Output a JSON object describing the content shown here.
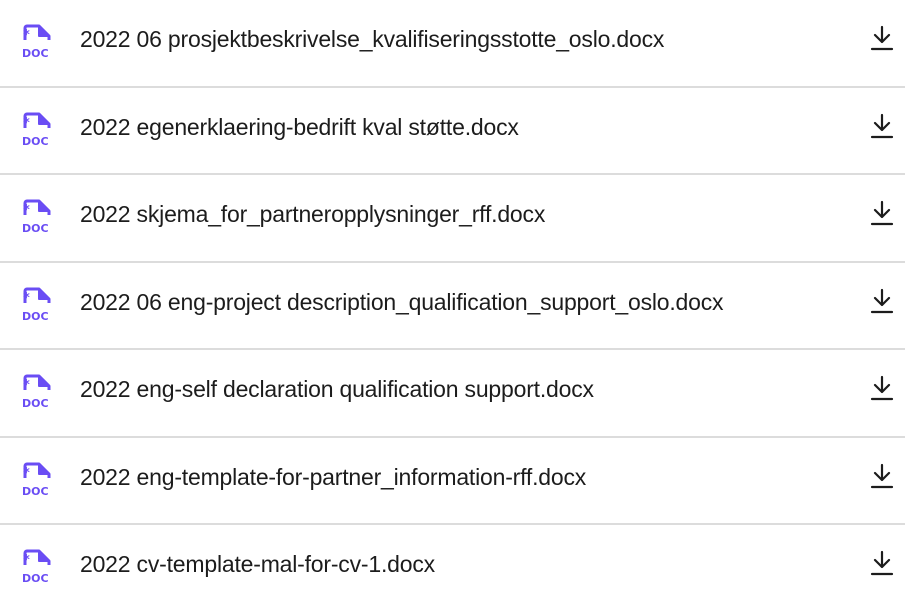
{
  "colors": {
    "icon_accent": "#6a4df4",
    "text": "#1c1c1c",
    "divider": "#dcdcdc",
    "download_icon": "#1c1c1c"
  },
  "icons": {
    "file": "doc-file-icon",
    "file_badge_text": "DOC",
    "download": "download-icon"
  },
  "files": [
    {
      "name": "2022 06 prosjektbeskrivelse_kvalifiseringsstotte_oslo.docx"
    },
    {
      "name": "2022 egenerklaering-bedrift kval støtte.docx"
    },
    {
      "name": "2022 skjema_for_partneropplysninger_rff.docx"
    },
    {
      "name": "2022 06 eng-project description_qualification_support_oslo.docx"
    },
    {
      "name": "2022 eng-self declaration qualification support.docx"
    },
    {
      "name": "2022 eng-template-for-partner_information-rff.docx"
    },
    {
      "name": "2022 cv-template-mal-for-cv-1.docx"
    }
  ]
}
